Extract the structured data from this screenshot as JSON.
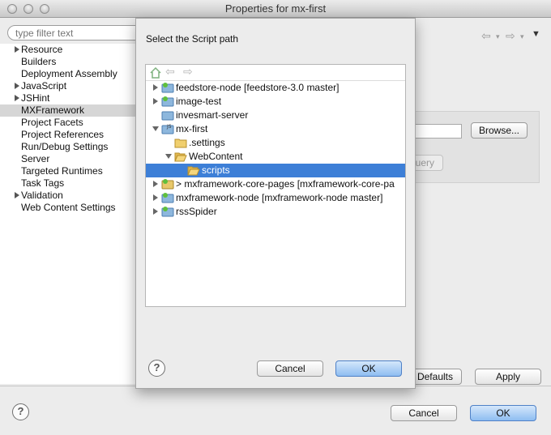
{
  "window": {
    "title": "Properties for mx-first"
  },
  "filter": {
    "placeholder": "type filter text"
  },
  "nav": {
    "items": [
      {
        "label": "Resource",
        "expandable": true
      },
      {
        "label": "Builders",
        "expandable": false
      },
      {
        "label": "Deployment Assembly",
        "expandable": false
      },
      {
        "label": "JavaScript",
        "expandable": true
      },
      {
        "label": "JSHint",
        "expandable": true
      },
      {
        "label": "MXFramework",
        "expandable": false,
        "selected": true
      },
      {
        "label": "Project Facets",
        "expandable": false
      },
      {
        "label": "Project References",
        "expandable": false
      },
      {
        "label": "Run/Debug Settings",
        "expandable": false
      },
      {
        "label": "Server",
        "expandable": false
      },
      {
        "label": "Targeted Runtimes",
        "expandable": false
      },
      {
        "label": "Task Tags",
        "expandable": false
      },
      {
        "label": "Validation",
        "expandable": true
      },
      {
        "label": "Web Content Settings",
        "expandable": false
      }
    ]
  },
  "right_panel": {
    "browse_label": "Browse...",
    "query_label": "uery",
    "defaults_label": "Defaults",
    "apply_label": "Apply"
  },
  "footer": {
    "cancel_label": "Cancel",
    "ok_label": "OK"
  },
  "dialog": {
    "title": "Select the Script path",
    "tree": [
      {
        "label": "feedstore-node  [feedstore-3.0 master]",
        "depth": 0,
        "twisty": "closed",
        "icon": "project-git-icon"
      },
      {
        "label": "image-test",
        "depth": 0,
        "twisty": "closed",
        "icon": "project-git-icon"
      },
      {
        "label": "invesmart-server",
        "depth": 0,
        "twisty": "none",
        "icon": "project-closed-icon"
      },
      {
        "label": "mx-first",
        "depth": 0,
        "twisty": "open",
        "icon": "project-js-icon"
      },
      {
        "label": ".settings",
        "depth": 1,
        "twisty": "none",
        "icon": "folder-icon"
      },
      {
        "label": "WebContent",
        "depth": 1,
        "twisty": "open",
        "icon": "folder-open-icon"
      },
      {
        "label": "scripts",
        "depth": 2,
        "twisty": "none",
        "icon": "folder-open-icon",
        "selected": true
      },
      {
        "label": "> mxframework-core-pages  [mxframework-core-pa",
        "depth": 0,
        "twisty": "closed",
        "icon": "project-git-icon"
      },
      {
        "label": "mxframework-node  [mxframework-node master]",
        "depth": 0,
        "twisty": "closed",
        "icon": "project-git-icon"
      },
      {
        "label": "rssSpider",
        "depth": 0,
        "twisty": "closed",
        "icon": "project-git-icon"
      }
    ],
    "cancel_label": "Cancel",
    "ok_label": "OK"
  },
  "colors": {
    "selection": "#3d7fd7",
    "default_button": "#8ebdf1"
  }
}
